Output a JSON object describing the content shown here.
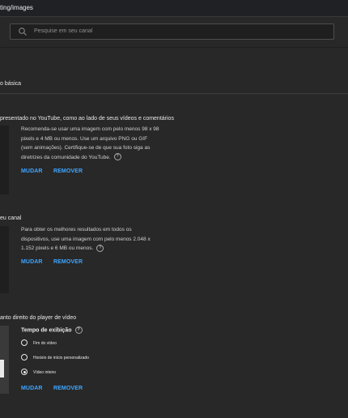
{
  "browser": {
    "url_fragment": "ting/images"
  },
  "search": {
    "placeholder": "Pesquise em seu canal"
  },
  "tabs": {
    "active": "o básica"
  },
  "picture_section": {
    "title": "presentado no YouTube, como ao lado de seus vídeos e comentários",
    "description": "Recomenda-se usar uma imagem com pelo menos 98 x 98 pixels e 4 MB ou menos. Use um arquivo PNG ou GIF (sem animações). Certifique-se de que sua foto siga as diretrizes da comunidade do YouTube.",
    "change_label": "MUDAR",
    "remove_label": "REMOVER"
  },
  "banner_section": {
    "title": "eu canal",
    "description": "Para obter os melhores resultados em todos os dispositivos, use uma imagem com pelo menos 2.048 x 1.152 pixels e 6 MB ou menos.",
    "change_label": "MUDAR",
    "remove_label": "REMOVER"
  },
  "watermark_section": {
    "title": "anto direito do player de vídeo",
    "display_time_label": "Tempo de exibição",
    "options": [
      "Fim do vídeo",
      "Horário de início personalizado",
      "Vídeo inteiro"
    ],
    "selected_option": "Vídeo inteiro",
    "change_label": "MUDAR",
    "remove_label": "REMOVER"
  },
  "help_glyph": "?"
}
